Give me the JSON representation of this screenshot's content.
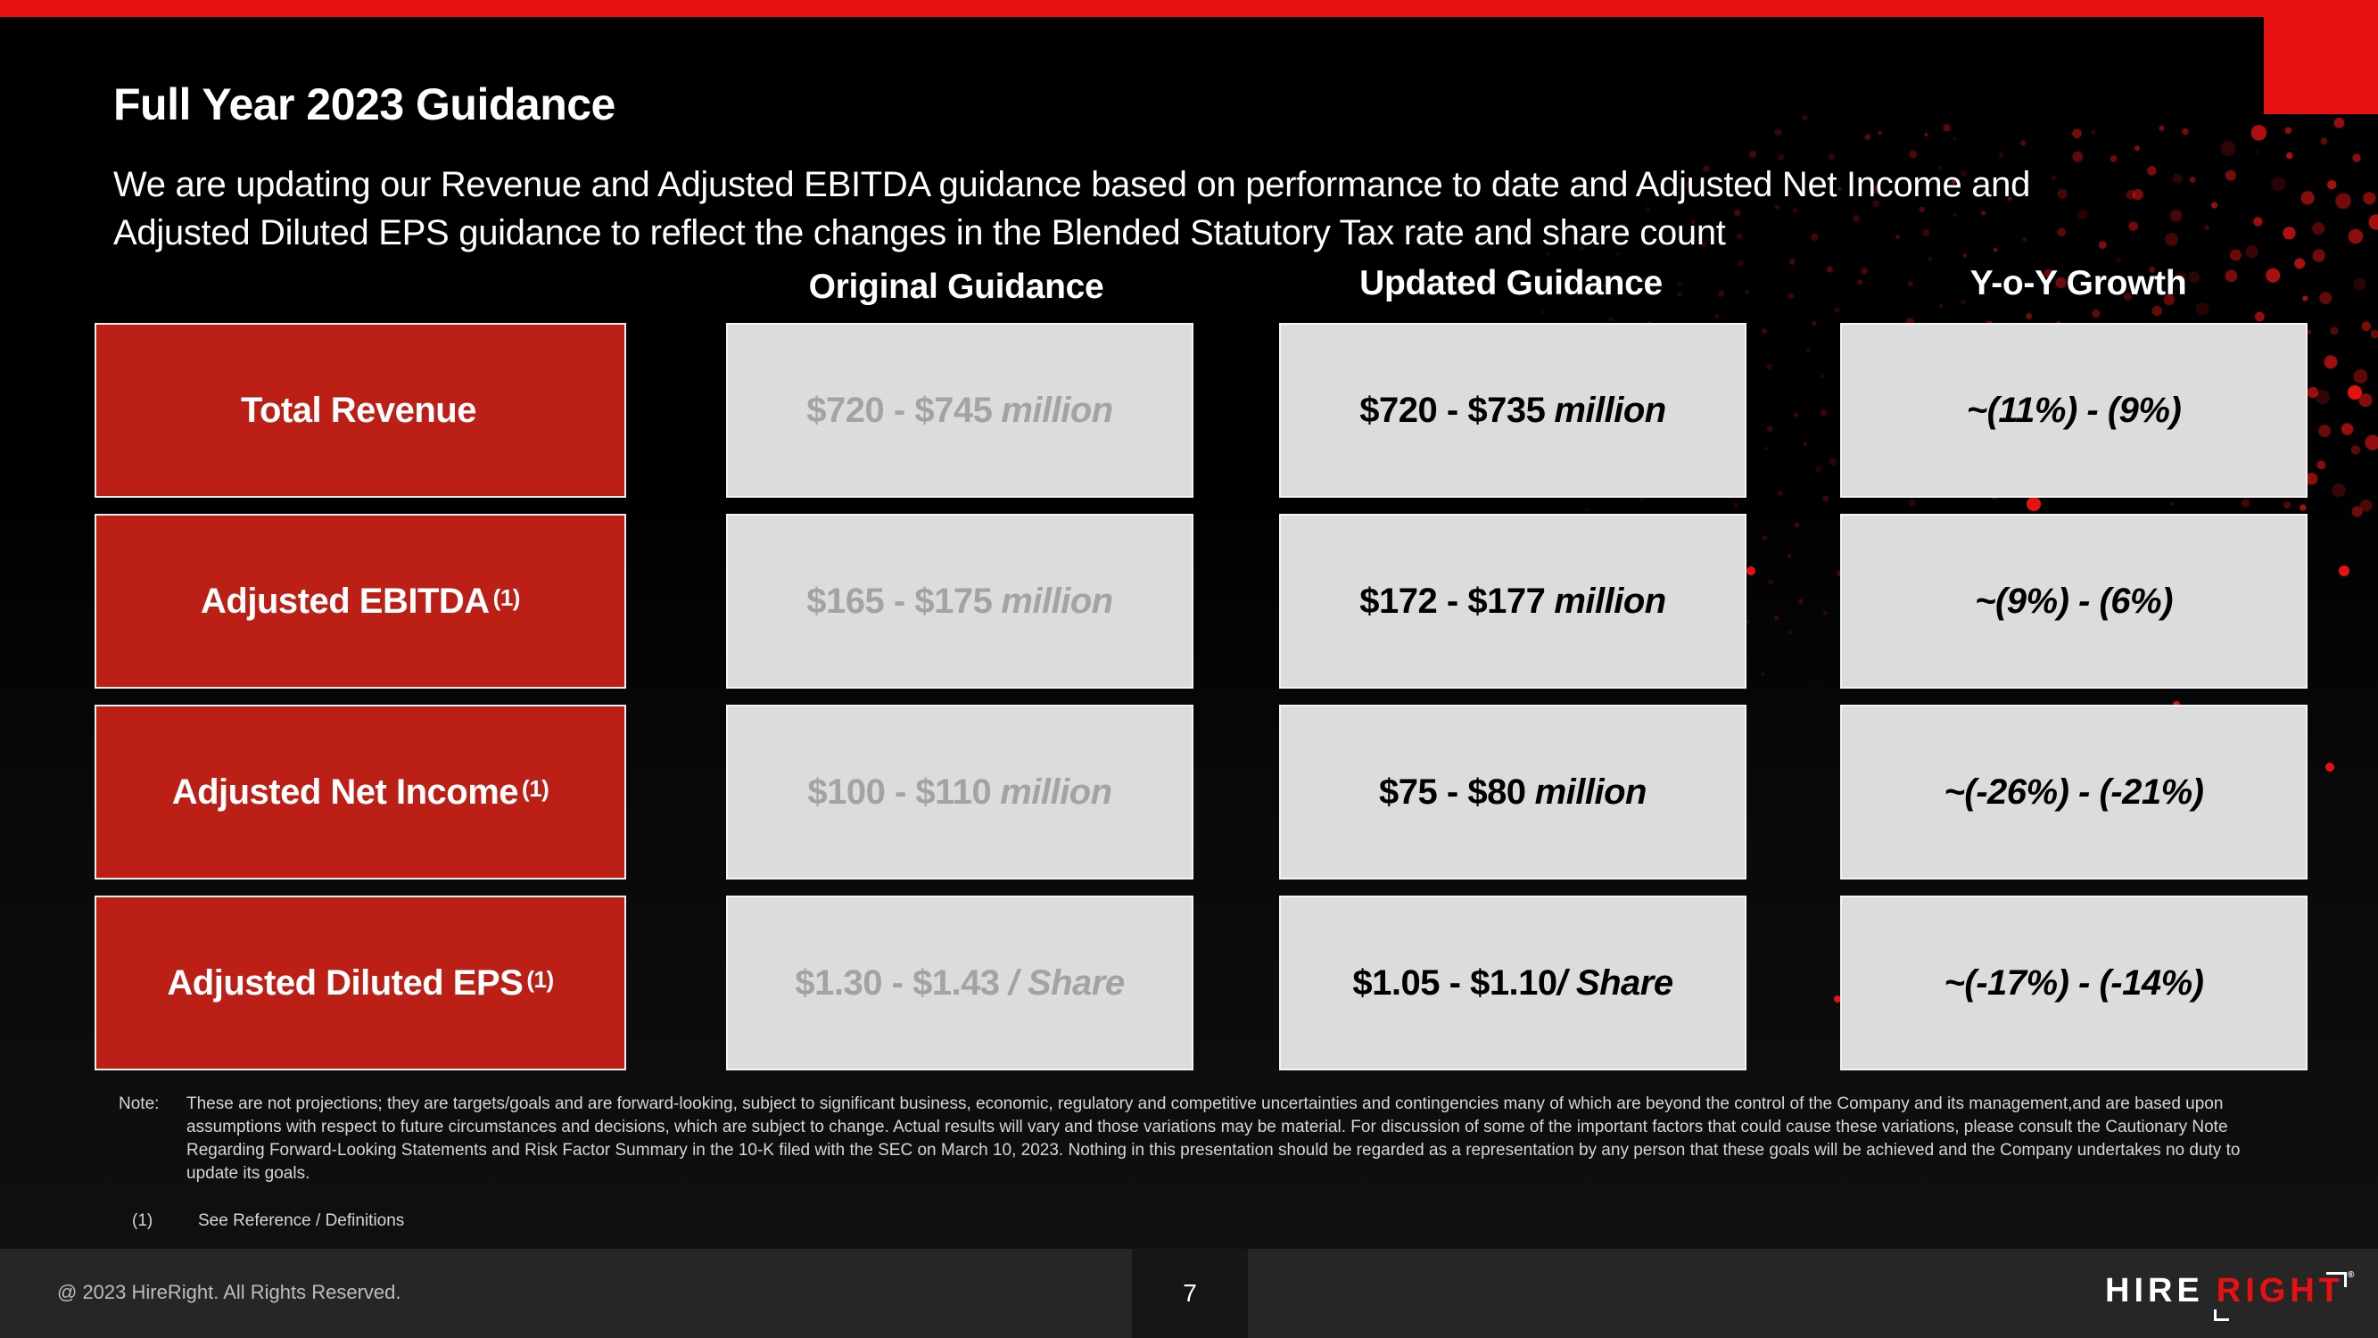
{
  "slide": {
    "title": "Full Year 2023 Guidance",
    "subtitle": "We are updating our Revenue and Adjusted EBITDA guidance based on performance to date and  Adjusted Net Income and Adjusted Diluted EPS guidance to reflect the changes in the Blended Statutory Tax rate and share count",
    "columns": {
      "original": "Original Guidance",
      "updated": "Updated Guidance",
      "yoy": "Y-o-Y Growth"
    },
    "rows": [
      {
        "label": "Total Revenue",
        "footnote": "",
        "original": {
          "range": "$720 - $745",
          "unit": "million"
        },
        "updated": {
          "range": "$720 - $735",
          "unit": "million"
        },
        "yoy": "~(11%) - (9%)"
      },
      {
        "label": "Adjusted EBITDA",
        "footnote": "(1)",
        "original": {
          "range": "$165 - $175",
          "unit": "million"
        },
        "updated": {
          "range": "$172 - $177",
          "unit": "million"
        },
        "yoy": "~(9%) - (6%)"
      },
      {
        "label": "Adjusted Net Income ",
        "footnote": "(1)",
        "original": {
          "range": "$100 - $110",
          "unit": "million"
        },
        "updated": {
          "range": "$75 - $80",
          "unit": "million"
        },
        "yoy": "~(-26%) - (-21%)"
      },
      {
        "label": "Adjusted Diluted EPS ",
        "footnote": "(1)",
        "original": {
          "range": "$1.30 - $1.43 ",
          "unit": "/ Share"
        },
        "updated": {
          "range": "$1.05 - $1.10",
          "unit": "/ Share"
        },
        "yoy": "~(-17%) - (-14%)"
      }
    ],
    "note_label": "Note:",
    "note_text": "These are not projections; they are targets/goals and are forward-looking, subject to significant business, economic, regulatory and competitive uncertainties and contingencies many of which are beyond the control of the Company and its management,and are based upon assumptions with respect to future circumstances and decisions, which are subject to change. Actual results will vary and those variations may be material. For discussion of some of the important factors that could cause these variations, please consult the Cautionary Note Regarding Forward-Looking Statements and Risk Factor Summary in the 10-K filed with the SEC on March 10, 2023. Nothing in this presentation should be regarded as a representation by any person that these goals will be achieved and the Company undertakes no duty to update its goals.",
    "reference_num": "(1)",
    "reference_text": "See Reference / Definitions"
  },
  "footer": {
    "copyright": "@ 2023  HireRight. All Rights Reserved.",
    "page_number": "7",
    "logo_part1": "HIRE",
    "logo_part2": "RIGHT",
    "logo_reg": "®"
  },
  "colors": {
    "brand_red": "#e71111",
    "label_red": "#bb1f15",
    "cell_gray": "#dcdcdc",
    "muted_text": "#a3a3a3"
  }
}
